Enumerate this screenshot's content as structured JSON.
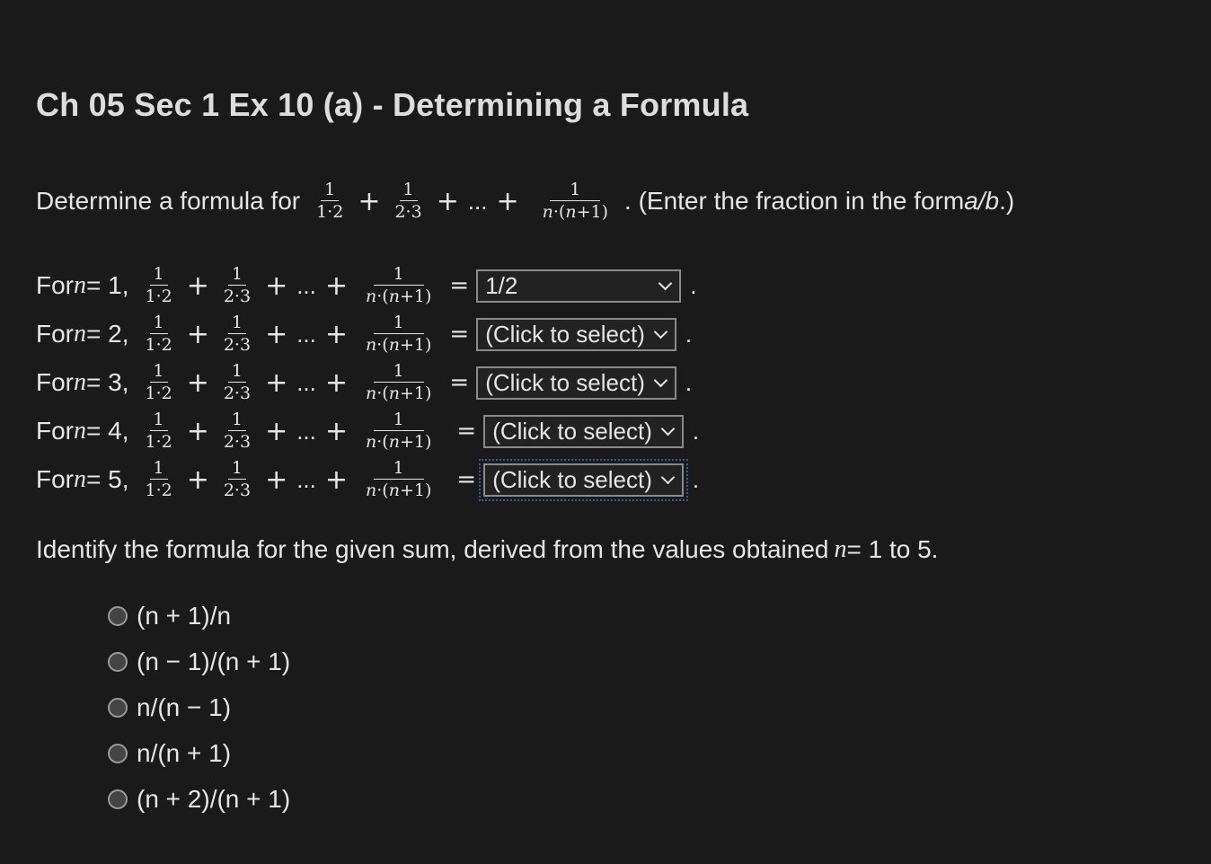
{
  "title": "Ch 05 Sec 1 Ex 10 (a) - Determining a Formula",
  "intro": {
    "prefix": "Determine a formula for",
    "suffix": ". (Enter the fraction in the form ",
    "form": "a/b",
    "close": ".)"
  },
  "fractions": {
    "one": "1",
    "d1": "1·2",
    "d2": "2·3",
    "dn_a": "n",
    "dn_b": "·(",
    "dn_c": "n",
    "dn_d": "+1)"
  },
  "symbols": {
    "plus": "+",
    "ellipsis": "...",
    "equals": "=",
    "period": "."
  },
  "rows": [
    {
      "for": "For ",
      "var": "n",
      "eq": " = 1,",
      "selected": "1/2"
    },
    {
      "for": "For ",
      "var": "n",
      "eq": " = 2,",
      "selected": "(Click to select)"
    },
    {
      "for": "For ",
      "var": "n",
      "eq": " = 3,",
      "selected": "(Click to select)"
    },
    {
      "for": "For ",
      "var": "n",
      "eq": " = 4,",
      "selected": "(Click to select)"
    },
    {
      "for": "For ",
      "var": "n",
      "eq": " = 5,",
      "selected": "(Click to select)"
    }
  ],
  "identify": {
    "text": "Identify the formula for the given sum, derived from the values obtained ",
    "var": "n",
    "range": " = 1 to 5."
  },
  "options": [
    "(n + 1)/n",
    "(n − 1)/(n + 1)",
    "n/(n − 1)",
    "n/(n + 1)",
    "(n + 2)/(n + 1)"
  ]
}
